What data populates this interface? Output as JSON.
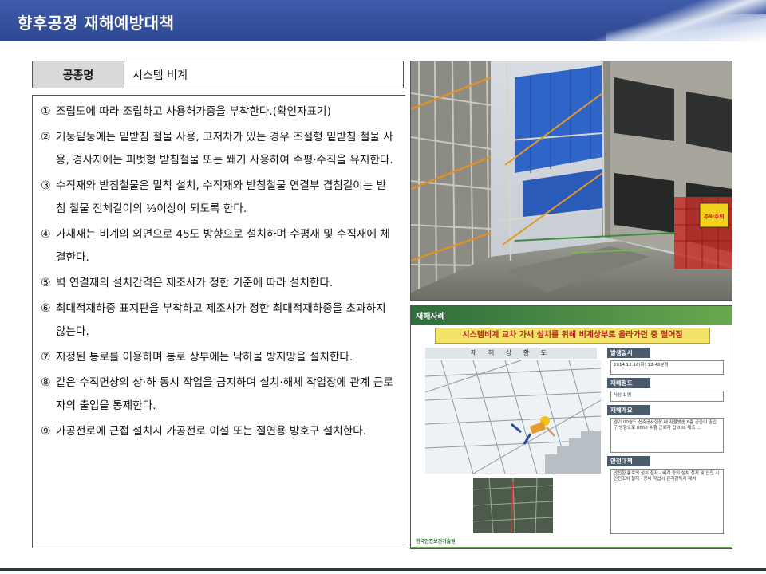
{
  "page_title": "향후공정 재해예방대책",
  "header": {
    "label": "공종명",
    "value": "시스템 비계"
  },
  "items": [
    {
      "num": "①",
      "text": "조립도에 따라 조립하고 사용허가중을 부착한다.(확인자표기)"
    },
    {
      "num": "②",
      "text": "기둥밑둥에는 밑받침 철물 사용, 고저차가 있는 경우 조절형 밑받침 철물 사용, 경사지에는 피벗형 받침철물 또는 쐐기 사용하여 수평·수직을 유지한다."
    },
    {
      "num": "③",
      "text": "수직재와 받침철물은 밀착 설치, 수직재와 받침철물 연결부 겹침길이는 받침 철물 전체길이의 ⅓이상이 되도록 한다."
    },
    {
      "num": "④",
      "text": "가새재는 비계의 외면으로 45도 방향으로 설치하며 수평재 및 수직재에 체결한다."
    },
    {
      "num": "⑤",
      "text": "벽 연결재의 설치간격은 제조사가 정한 기준에 따라 설치한다."
    },
    {
      "num": "⑥",
      "text": "최대적재하중 표지판을 부착하고 제조사가 정한 최대적재하중을 초과하지 않는다."
    },
    {
      "num": "⑦",
      "text": "지정된 통로를 이용하며 통로 상부에는 낙하물 방지망을 설치한다."
    },
    {
      "num": "⑧",
      "text": "같은 수직면상의 상·하 동시 작업을 금지하며 설치·해체 작업장에 관계 근로자의 출입을 통제한다."
    },
    {
      "num": "⑨",
      "text": "가공전로에 근접 설치시 가공전로 이설 또는 절연용 방호구 설치한다."
    }
  ],
  "case": {
    "tag": "재해사례",
    "headline": "시스템비계 교차 가새 설치를 위해 비계상부로 올라가던 중 떨어짐",
    "diagram_title": "재 해 상 황 도",
    "sections": [
      {
        "label": "발생일시",
        "body": "2014.12.16(화) 12:48분경"
      },
      {
        "label": "재해정도",
        "body": "사상 1 명"
      },
      {
        "label": "재해개요",
        "body": "경기 00월드 신축공사현장 내 자율방송 8층 공중이 출입구 방향으로 0000 수행 근로자 갑 000 제조 ..."
      },
      {
        "label": "안전대책",
        "body": "안전한 통로의 설치 철저 · 비계 등의 설치 철저 및 안전 시 안전조치 철저 · 장비 작업시 관리감독자 배치"
      }
    ],
    "sign_text": "추락주의",
    "footer": "한국안전보건기술원"
  },
  "colors": {
    "title_bar": "#2e4891",
    "header_label_bg": "#d9d9d9",
    "case_green": "#2f6d3b",
    "headline_bg": "#f2e36b",
    "headline_text": "#b5281f"
  }
}
